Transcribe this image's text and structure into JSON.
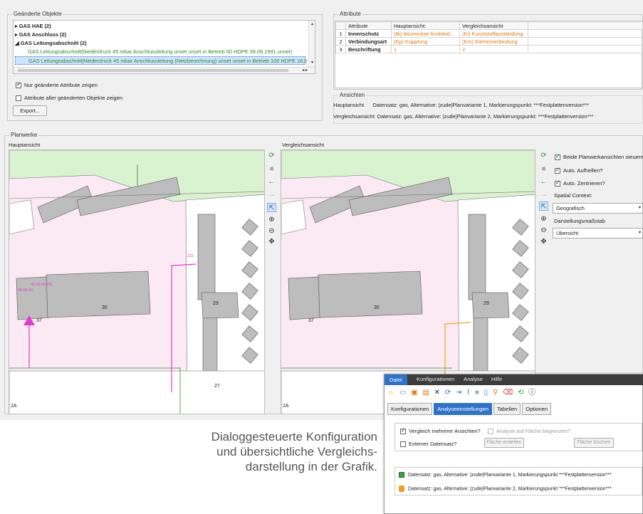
{
  "changed_objects": {
    "title": "Geänderte Objekte",
    "tree": [
      {
        "label": "GAS HAE (2)",
        "style": "bold",
        "prefix": "▸"
      },
      {
        "label": "GAS Anschluss (2)",
        "style": "bold",
        "prefix": "▸"
      },
      {
        "label": "GAS Leitungsabschnitt (2)",
        "style": "bold",
        "prefix": "◢"
      },
      {
        "label": "GAS Leitungsabschnitt|Niederdruck 45 mbar Anschlussleitung unset unset in Betrieb 50 HDPE 09.09.1991 unset)",
        "style": "green",
        "prefix": ""
      },
      {
        "label": "GAS Leitungsabschnitt|Niederdruck 45 mbar Anschlussleitung (Netzberechnung) unset unset in Betrieb 100 HDPE 16.0",
        "style": "sel",
        "prefix": ""
      }
    ],
    "only_changed_label": "Nur geänderte Attribute zeigen",
    "all_attr_label": "Attribute aller geänderten Objekte zeigen",
    "export_label": "Export..."
  },
  "attributes": {
    "title": "Attribute",
    "headers": [
      "",
      "Attribute",
      "Hauptansicht:",
      "Vergleichsansicht"
    ],
    "rows": [
      {
        "n": "1",
        "name": "Innenschutz",
        "main": "(Bi) bituminöse Auskleid...",
        "cmp": "(Ki) Kunststoffauskleidung"
      },
      {
        "n": "2",
        "name": "Verbindungsart",
        "main": "(Kp) Kupplung",
        "cmp": "(Km) Klemmverbindung"
      },
      {
        "n": "3",
        "name": "Beschriftung",
        "main": "1",
        "cmp": "2"
      }
    ]
  },
  "views": {
    "title": "Ansichten",
    "main_label": "Hauptansicht",
    "main_text": "Datensatz: gas, Alternative: |zude|Planvariante 1, Markierungspunkt: ***Festplattenversion***",
    "cmp_label": "Vergleichsansicht:",
    "cmp_text": "Datensatz: gas, Alternative: |zude|Planvariante 2, Markierungspunkt: ***Festplattenversion***"
  },
  "planwerke": {
    "title": "Planwerke",
    "main_title": "Hauptansicht",
    "cmp_title": "Vergleichsansicht",
    "map_labels": {
      "a": "35",
      "b": "37",
      "c": "29",
      "d": "27",
      "e": "2A",
      "f": "46.95 HDPE",
      "g": "09.09.91",
      "h": "222"
    },
    "options": {
      "steer": "Beide Planwerkansichten steuern",
      "brighten": "Auto. Aufhellen?",
      "center": "Auto. Zentrieren?",
      "spatial_label": "Spatial Context:",
      "spatial_value": "Geografisch",
      "scale_label": "Darstellungsmaßstab",
      "scale_value": "Übersicht"
    }
  },
  "config": {
    "menu": [
      "Datei",
      "Konfigurationen",
      "Analyse",
      "Hilfe"
    ],
    "tabs": [
      "Konfigurationen",
      "Analyseeinstellungen",
      "Tabellen",
      "Optionen"
    ],
    "multi_view": "Vergleich mehrerer Ansichten?",
    "limit_area": "Analyse auf Fläche begrenzen?",
    "external": "Externer Datensatz?",
    "create_area": "Fläche erstellen",
    "delete_area": "Fläche löschen",
    "datasets": [
      "Datensatz: gas, Alternative: |zude|Planvariante 1, Markierungspunkt ***Festplattenversion***",
      "Datensatz: gas, Alternative: |zude|Planvariante 2, Markierungspunkt ***Festplattenversion***"
    ],
    "accent": "#2f73c9"
  },
  "caption": [
    "Dialoggesteuerte Konfiguration",
    "und übersichtliche Vergleichs-",
    "darstellung in der Grafik."
  ]
}
